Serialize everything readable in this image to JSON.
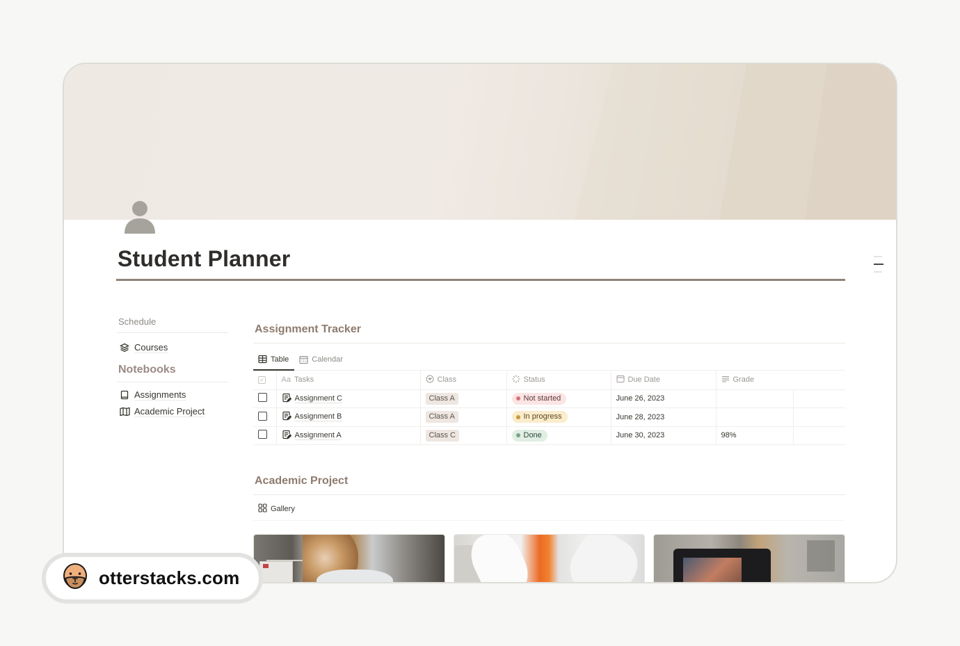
{
  "page": {
    "title": "Student Planner",
    "icon": "person-icon"
  },
  "sidebar": {
    "schedule_label": "Schedule",
    "items_top": [
      {
        "label": "Courses",
        "icon": "layers-icon"
      }
    ],
    "notebooks_heading": "Notebooks",
    "notebook_items": [
      {
        "label": "Assignments",
        "icon": "book-icon"
      },
      {
        "label": "Academic Project",
        "icon": "map-icon"
      }
    ]
  },
  "assignment_tracker": {
    "title": "Assignment Tracker",
    "views": [
      {
        "label": "Table",
        "icon": "table-icon",
        "active": true
      },
      {
        "label": "Calendar",
        "icon": "calendar-icon",
        "active": false
      }
    ],
    "columns": [
      {
        "label": "",
        "icon": "checkbox-icon"
      },
      {
        "label": "Tasks",
        "icon": "text-aa-icon",
        "icon_text": "Aa"
      },
      {
        "label": "Class",
        "icon": "select-icon"
      },
      {
        "label": "Status",
        "icon": "status-icon"
      },
      {
        "label": "Due Date",
        "icon": "calendar-icon"
      },
      {
        "label": "Grade",
        "icon": "text-lines-icon"
      }
    ],
    "rows": [
      {
        "done": false,
        "task": "Assignment C",
        "class": "Class A",
        "status": "Not started",
        "status_key": "not_started",
        "due": "June 26, 2023",
        "grade": ""
      },
      {
        "done": false,
        "task": "Assignment B",
        "class": "Class A",
        "status": "In progress",
        "status_key": "in_progress",
        "due": "June 28, 2023",
        "grade": ""
      },
      {
        "done": false,
        "task": "Assignment A",
        "class": "Class C",
        "status": "Done",
        "status_key": "done",
        "due": "June 30, 2023",
        "grade": "98%"
      }
    ],
    "status_colors": {
      "not_started": {
        "bg": "#fbe4e4",
        "dot": "#d4737a",
        "text": "#5e3b3b"
      },
      "in_progress": {
        "bg": "#fbeccb",
        "dot": "#c69a3d",
        "text": "#5a4620"
      },
      "done": {
        "bg": "#e1eee3",
        "dot": "#7aa584",
        "text": "#2f4b35"
      }
    }
  },
  "academic_project": {
    "title": "Academic Project",
    "views": [
      {
        "label": "Gallery",
        "icon": "gallery-icon",
        "active": true
      }
    ],
    "cards": [
      {
        "image": "student-in-lab-photo"
      },
      {
        "image": "gloved-hands-microscope-photo"
      },
      {
        "image": "camera-filming-photo"
      }
    ]
  },
  "watermark": {
    "site": "otterstacks.com",
    "icon": "otter-face-icon"
  },
  "colors": {
    "accent_heading": "#8e7b6f",
    "title_rule": "#8e837a",
    "background": "#f7f7f5"
  }
}
